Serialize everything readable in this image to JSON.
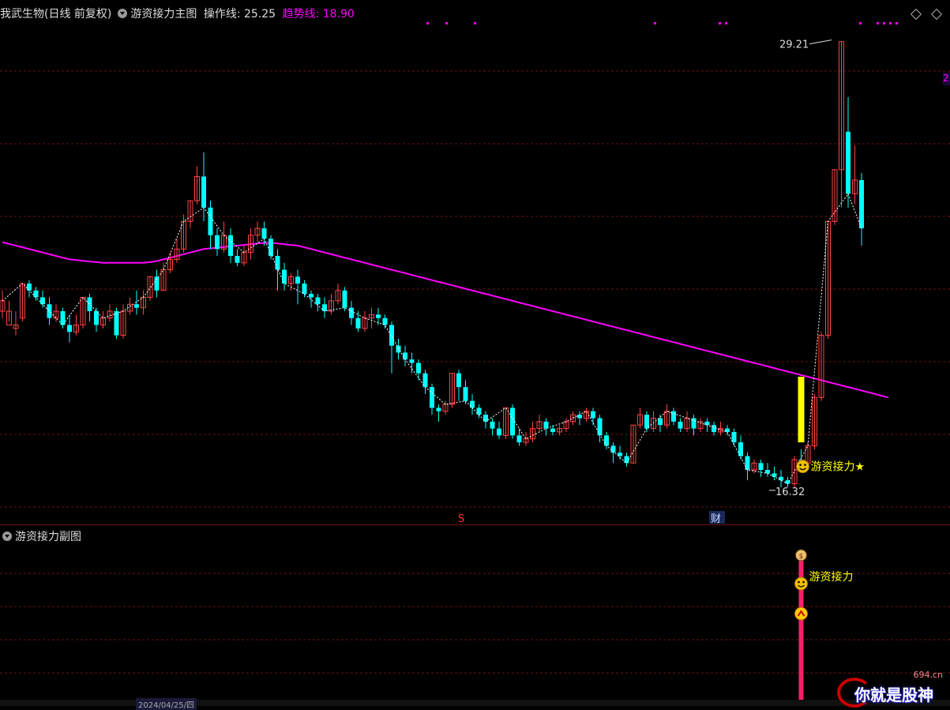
{
  "header": {
    "stock_name": "我武生物(日线 前复权)",
    "indicator_name": "游资接力主图",
    "op_line_label": "操作线: 25.25",
    "trend_line_label": "趋势线: 18.90"
  },
  "sub_panel": {
    "title": "游资接力副图",
    "signal_label": "游资接力"
  },
  "markers": {
    "high_label": "29.21",
    "low_label": "16.32",
    "signal_label": "游资接力★",
    "s_mark": "S",
    "cai_mark": "财",
    "date_label": "2024/04/25/四",
    "right_price_tag": "2"
  },
  "watermark": {
    "text": "你就是股神",
    "site": "694.cn"
  },
  "colors": {
    "up": "#ff4444",
    "down": "#00ffff",
    "trend": "#ff00ff",
    "signal": "#ffff00",
    "grid": "#6e1010"
  },
  "chart_data": {
    "type": "candlestick",
    "ylim": [
      16.0,
      29.5
    ],
    "candles": [
      [
        21.4,
        21.7,
        21.2,
        22.0
      ],
      [
        21.0,
        21.4,
        21.1,
        21.7
      ],
      [
        20.9,
        21.0,
        20.7,
        21.4
      ],
      [
        21.2,
        22.2,
        21.1,
        22.2
      ],
      [
        22.2,
        22.0,
        21.8,
        22.3
      ],
      [
        22.0,
        21.8,
        21.7,
        22.1
      ],
      [
        21.8,
        21.6,
        21.5,
        22.0
      ],
      [
        21.6,
        21.2,
        21.0,
        21.8
      ],
      [
        21.2,
        21.4,
        21.1,
        21.6
      ],
      [
        21.4,
        21.0,
        20.9,
        21.5
      ],
      [
        21.0,
        20.8,
        20.5,
        21.3
      ],
      [
        20.8,
        21.0,
        20.7,
        21.3
      ],
      [
        21.0,
        21.8,
        20.9,
        21.8
      ],
      [
        21.8,
        21.4,
        21.1,
        21.9
      ],
      [
        21.4,
        21.0,
        20.8,
        21.5
      ],
      [
        21.0,
        21.2,
        20.9,
        21.4
      ],
      [
        21.2,
        21.4,
        21.1,
        21.6
      ],
      [
        21.4,
        20.7,
        20.6,
        21.5
      ],
      [
        20.7,
        21.4,
        20.6,
        21.6
      ],
      [
        21.4,
        21.6,
        21.3,
        21.8
      ],
      [
        21.6,
        21.5,
        21.3,
        22.0
      ],
      [
        21.5,
        21.8,
        21.3,
        22.0
      ],
      [
        21.8,
        22.4,
        21.7,
        22.4
      ],
      [
        22.4,
        22.0,
        21.8,
        22.6
      ],
      [
        22.0,
        22.6,
        22.0,
        22.8
      ],
      [
        22.6,
        22.9,
        22.5,
        23.1
      ],
      [
        22.9,
        23.2,
        22.8,
        23.5
      ],
      [
        23.2,
        24.0,
        23.1,
        24.2
      ],
      [
        24.0,
        24.6,
        23.8,
        24.6
      ],
      [
        24.6,
        25.3,
        24.5,
        25.6
      ],
      [
        25.3,
        24.4,
        24.0,
        26.0
      ],
      [
        24.4,
        23.6,
        23.2,
        24.6
      ],
      [
        23.6,
        23.2,
        23.0,
        23.8
      ],
      [
        23.2,
        23.6,
        23.1,
        24.0
      ],
      [
        23.6,
        23.0,
        22.8,
        23.8
      ],
      [
        23.0,
        22.8,
        22.7,
        23.2
      ],
      [
        22.8,
        23.1,
        22.7,
        23.3
      ],
      [
        23.1,
        23.6,
        22.9,
        23.8
      ],
      [
        23.6,
        23.8,
        23.4,
        24.0
      ],
      [
        23.8,
        23.5,
        23.3,
        24.0
      ],
      [
        23.5,
        23.0,
        22.9,
        23.6
      ],
      [
        23.0,
        22.6,
        22.0,
        23.2
      ],
      [
        22.6,
        22.2,
        22.0,
        22.8
      ],
      [
        22.2,
        22.4,
        22.0,
        22.5
      ],
      [
        22.4,
        22.2,
        21.6,
        22.6
      ],
      [
        22.2,
        21.9,
        21.8,
        22.3
      ],
      [
        21.9,
        21.8,
        21.5,
        22.0
      ],
      [
        21.8,
        21.6,
        21.4,
        21.9
      ],
      [
        21.6,
        21.4,
        21.2,
        21.8
      ],
      [
        21.4,
        21.7,
        21.3,
        21.9
      ],
      [
        21.7,
        22.0,
        21.6,
        22.2
      ],
      [
        22.0,
        21.5,
        21.4,
        22.1
      ],
      [
        21.5,
        21.2,
        21.0,
        21.7
      ],
      [
        21.2,
        20.9,
        20.8,
        21.4
      ],
      [
        20.9,
        21.2,
        20.8,
        21.4
      ],
      [
        21.2,
        21.3,
        20.9,
        21.5
      ],
      [
        21.3,
        21.2,
        21.0,
        21.5
      ],
      [
        21.2,
        21.0,
        20.9,
        21.3
      ],
      [
        21.0,
        20.4,
        19.6,
        21.1
      ],
      [
        20.4,
        20.2,
        20.0,
        20.6
      ],
      [
        20.2,
        20.0,
        19.8,
        20.4
      ],
      [
        20.0,
        19.9,
        19.6,
        20.2
      ],
      [
        19.9,
        19.6,
        19.4,
        20.0
      ],
      [
        19.6,
        19.2,
        19.0,
        19.7
      ],
      [
        19.2,
        18.6,
        18.4,
        19.3
      ],
      [
        18.6,
        18.5,
        18.2,
        18.7
      ],
      [
        18.5,
        18.7,
        18.4,
        18.8
      ],
      [
        18.7,
        19.6,
        18.6,
        19.6
      ],
      [
        19.6,
        19.2,
        18.8,
        19.7
      ],
      [
        19.2,
        18.8,
        18.7,
        19.4
      ],
      [
        18.8,
        18.6,
        18.4,
        19.0
      ],
      [
        18.6,
        18.4,
        18.3,
        18.7
      ],
      [
        18.4,
        18.2,
        18.0,
        18.5
      ],
      [
        18.2,
        18.0,
        17.8,
        18.3
      ],
      [
        18.0,
        17.8,
        17.7,
        18.2
      ],
      [
        17.8,
        18.6,
        17.7,
        18.6
      ],
      [
        18.6,
        17.8,
        17.7,
        18.7
      ],
      [
        17.8,
        17.6,
        17.5,
        18.0
      ],
      [
        17.6,
        17.7,
        17.5,
        17.9
      ],
      [
        17.7,
        18.0,
        17.6,
        18.2
      ],
      [
        18.0,
        18.2,
        17.9,
        18.4
      ],
      [
        18.2,
        18.0,
        17.8,
        18.3
      ],
      [
        18.0,
        17.9,
        17.8,
        18.1
      ],
      [
        17.9,
        18.0,
        17.8,
        18.1
      ],
      [
        18.0,
        18.2,
        17.9,
        18.3
      ],
      [
        18.2,
        18.4,
        18.1,
        18.5
      ],
      [
        18.4,
        18.3,
        18.1,
        18.5
      ],
      [
        18.3,
        18.5,
        18.2,
        18.6
      ],
      [
        18.5,
        18.3,
        18.1,
        18.6
      ],
      [
        18.3,
        17.8,
        17.6,
        18.4
      ],
      [
        17.8,
        17.5,
        17.4,
        17.9
      ],
      [
        17.5,
        17.3,
        17.0,
        17.6
      ],
      [
        17.3,
        17.2,
        17.1,
        17.5
      ],
      [
        17.2,
        17.0,
        16.9,
        17.3
      ],
      [
        17.0,
        18.1,
        17.0,
        18.1
      ],
      [
        18.1,
        18.4,
        18.0,
        18.6
      ],
      [
        18.4,
        18.0,
        17.9,
        18.5
      ],
      [
        18.0,
        18.3,
        17.9,
        18.5
      ],
      [
        18.3,
        18.1,
        17.9,
        18.4
      ],
      [
        18.1,
        18.5,
        18.0,
        18.7
      ],
      [
        18.5,
        18.2,
        18.1,
        18.6
      ],
      [
        18.2,
        18.0,
        17.9,
        18.3
      ],
      [
        18.0,
        18.3,
        17.9,
        18.5
      ],
      [
        18.3,
        18.0,
        17.8,
        18.4
      ],
      [
        18.0,
        18.2,
        17.9,
        18.3
      ],
      [
        18.2,
        18.1,
        17.9,
        18.3
      ],
      [
        18.1,
        17.9,
        17.8,
        18.2
      ],
      [
        17.9,
        18.0,
        17.8,
        18.2
      ],
      [
        18.0,
        17.9,
        17.8,
        18.1
      ],
      [
        17.9,
        17.6,
        17.5,
        18.0
      ],
      [
        17.6,
        17.2,
        17.1,
        17.8
      ],
      [
        17.2,
        16.8,
        16.5,
        17.3
      ],
      [
        16.8,
        17.0,
        16.7,
        17.1
      ],
      [
        17.0,
        16.8,
        16.6,
        17.1
      ],
      [
        16.8,
        16.7,
        16.6,
        17.0
      ],
      [
        16.7,
        16.6,
        16.5,
        16.9
      ],
      [
        16.6,
        16.5,
        16.3,
        16.8
      ],
      [
        16.5,
        16.4,
        16.3,
        16.6
      ],
      [
        16.4,
        17.1,
        16.3,
        17.2
      ],
      [
        17.1,
        17.0,
        16.9,
        17.4
      ],
      [
        17.0,
        17.5,
        16.9,
        17.6
      ],
      [
        17.5,
        18.9,
        17.4,
        19.0
      ],
      [
        18.9,
        20.7,
        18.8,
        20.8
      ],
      [
        20.7,
        24.0,
        20.6,
        24.0
      ],
      [
        24.0,
        25.5,
        23.9,
        25.5
      ],
      [
        25.5,
        29.21,
        24.4,
        29.21
      ],
      [
        26.6,
        24.8,
        24.4,
        27.6
      ],
      [
        24.8,
        25.2,
        24.5,
        26.2
      ],
      [
        25.2,
        23.8,
        23.3,
        25.4
      ]
    ],
    "trend_line": [
      23.4,
      23.35,
      23.3,
      23.25,
      23.2,
      23.15,
      23.1,
      23.05,
      23.0,
      22.95,
      22.9,
      22.88,
      22.86,
      22.84,
      22.82,
      22.8,
      22.8,
      22.8,
      22.8,
      22.8,
      22.8,
      22.8,
      22.82,
      22.85,
      22.9,
      22.95,
      23.0,
      23.05,
      23.1,
      23.15,
      23.2,
      23.22,
      23.24,
      23.26,
      23.28,
      23.3,
      23.32,
      23.34,
      23.36,
      23.38,
      23.38,
      23.36,
      23.34,
      23.32,
      23.3,
      23.25,
      23.2,
      23.15,
      23.1,
      23.05,
      23.0,
      22.95,
      22.9,
      22.85,
      22.8,
      22.75,
      22.7,
      22.65,
      22.6,
      22.55,
      22.5,
      22.45,
      22.4,
      22.35,
      22.3,
      22.25,
      22.2,
      22.15,
      22.1,
      22.05,
      22.0,
      21.95,
      21.9,
      21.85,
      21.8,
      21.75,
      21.7,
      21.65,
      21.6,
      21.55,
      21.5,
      21.45,
      21.4,
      21.35,
      21.3,
      21.25,
      21.2,
      21.15,
      21.1,
      21.05,
      21.0,
      20.95,
      20.9,
      20.85,
      20.8,
      20.75,
      20.7,
      20.65,
      20.6,
      20.55,
      20.5,
      20.45,
      20.4,
      20.35,
      20.3,
      20.25,
      20.2,
      20.15,
      20.1,
      20.05,
      20.0,
      19.95,
      19.9,
      19.85,
      19.8,
      19.75,
      19.7,
      19.65,
      19.6,
      19.55,
      19.5,
      19.45,
      19.4,
      19.35,
      19.3,
      19.25,
      19.2,
      19.15,
      19.1,
      19.05,
      19.0,
      18.95,
      18.9
    ]
  }
}
